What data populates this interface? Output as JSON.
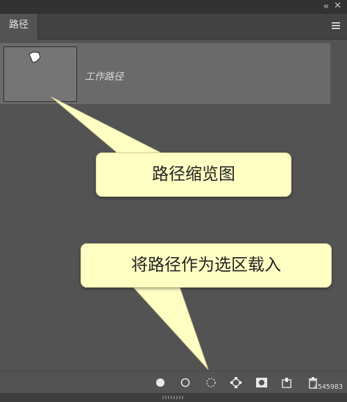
{
  "window": {
    "collapse_glyph": "‹‹",
    "close_glyph": "✕"
  },
  "panel": {
    "tab_label": "路径",
    "paths": [
      {
        "name": "工作路径"
      }
    ]
  },
  "toolbar": {
    "icons": [
      "fill-path-icon",
      "stroke-path-icon",
      "load-as-selection-icon",
      "make-work-path-icon",
      "add-mask-icon",
      "new-path-icon",
      "delete-path-icon"
    ]
  },
  "callouts": {
    "thumbnail_note": "路径缩览图",
    "selection_note": "将路径作为选区载入"
  },
  "watermark": "4545983",
  "colors": {
    "panel_bg": "#535353",
    "selected_row": "#6a6a6a",
    "callout_bg": "#ffffc4"
  }
}
